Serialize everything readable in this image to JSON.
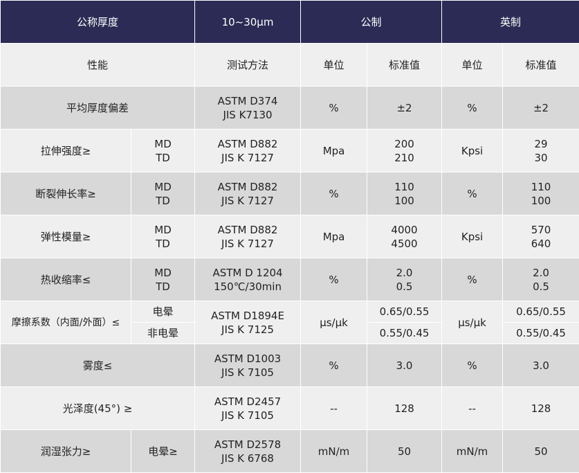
{
  "header": {
    "nominal_thickness": "公称厚度",
    "thickness_value": "10~30μm",
    "metric": "公制",
    "imperial": "英制"
  },
  "subheader": {
    "property": "性能",
    "test_method": "测试方法",
    "unit_metric": "单位",
    "standard_metric": "标准值",
    "unit_imperial": "单位",
    "standard_imperial": "标准值"
  },
  "rows": {
    "thickness_dev": {
      "property": "平均厚度偏差",
      "method": [
        "ASTM D374",
        "JIS K7130"
      ],
      "unit_m": "%",
      "value_m": "±2",
      "unit_i": "%",
      "value_i": "±2"
    },
    "tensile": {
      "property": "拉伸强度≥",
      "dir": [
        "MD",
        "TD"
      ],
      "method": [
        "ASTM D882",
        "JIS K 7127"
      ],
      "unit_m": "Mpa",
      "value_m": [
        "200",
        "210"
      ],
      "unit_i": "Kpsi",
      "value_i": [
        "29",
        "30"
      ]
    },
    "elongation": {
      "property": "断裂伸长率≥",
      "dir": [
        "MD",
        "TD"
      ],
      "method": [
        "ASTM D882",
        "JIS K 7127"
      ],
      "unit_m": "%",
      "value_m": [
        "110",
        "100"
      ],
      "unit_i": "%",
      "value_i": [
        "110",
        "100"
      ]
    },
    "modulus": {
      "property": "弹性模量≥",
      "dir": [
        "MD",
        "TD"
      ],
      "method": [
        "ASTM D882",
        "JIS K 7127"
      ],
      "unit_m": "Mpa",
      "value_m": [
        "4000",
        "4500"
      ],
      "unit_i": "Kpsi",
      "value_i": [
        "570",
        "640"
      ]
    },
    "shrinkage": {
      "property": "热收缩率≤",
      "dir": [
        "MD",
        "TD"
      ],
      "method": [
        "ASTM D 1204",
        "150℃/30min"
      ],
      "unit_m": "%",
      "value_m": [
        "2.0",
        "0.5"
      ],
      "unit_i": "%",
      "value_i": [
        "2.0",
        "0.5"
      ]
    },
    "friction": {
      "property": "摩擦系数（内面/外面）≤",
      "cond": [
        "电晕",
        "非电晕"
      ],
      "method": [
        "ASTM D1894E",
        "JIS K 7125"
      ],
      "unit_m": "μs/μk",
      "value_m": [
        "0.65/0.55",
        "0.55/0.45"
      ],
      "unit_i": "μs/μk",
      "value_i": [
        "0.65/0.55",
        "0.55/0.45"
      ]
    },
    "haze": {
      "property": "雾度≤",
      "method": [
        "ASTM D1003",
        "JIS K 7105"
      ],
      "unit_m": "%",
      "value_m": "3.0",
      "unit_i": "%",
      "value_i": "3.0"
    },
    "gloss": {
      "property": "光泽度(45°) ≥",
      "method": [
        "ASTM D2457",
        "JIS K 7105"
      ],
      "unit_m": "--",
      "value_m": "128",
      "unit_i": "--",
      "value_i": "128"
    },
    "wetting": {
      "property": "润湿张力≥",
      "cond": "电晕≥",
      "method": [
        "ASTM D2578",
        "JIS K 6768"
      ],
      "unit_m": "mN/m",
      "value_m": "50",
      "unit_i": "mN/m",
      "value_i": "50"
    }
  }
}
